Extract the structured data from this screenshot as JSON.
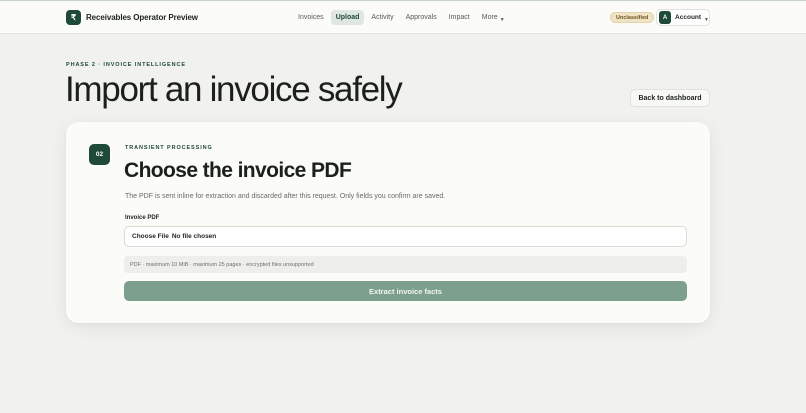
{
  "header": {
    "brand_icon": "₹",
    "brand_name": "Receivables Operator Preview",
    "nav": [
      {
        "label": "Invoices"
      },
      {
        "label": "Upload",
        "active": true
      },
      {
        "label": "Activity"
      },
      {
        "label": "Approvals"
      },
      {
        "label": "Impact"
      },
      {
        "label": "More"
      }
    ],
    "classification_badge": "Unclassified",
    "account": {
      "avatar_initial": "A",
      "label": "Account"
    }
  },
  "page": {
    "eyebrow": "PHASE 2 · INVOICE INTELLIGENCE",
    "title": "Import an invoice safely",
    "back_button": "Back to dashboard"
  },
  "card": {
    "step": "02",
    "eyebrow": "TRANSIENT PROCESSING",
    "title": "Choose the invoice PDF",
    "description": "The PDF is sent inline for extraction and discarded after this request. Only fields you confirm are saved.",
    "field_label": "Invoice PDF",
    "file_button": "Choose File",
    "file_status": "No file chosen",
    "hint": "PDF · maximum 10 MiB · maximum 25 pages · encrypted files unsupported",
    "submit_label": "Extract invoice facts"
  },
  "colors": {
    "brand": "#1e4a37",
    "submit_disabled": "#7d9f8d",
    "badge_bg": "#f1e4c6"
  }
}
